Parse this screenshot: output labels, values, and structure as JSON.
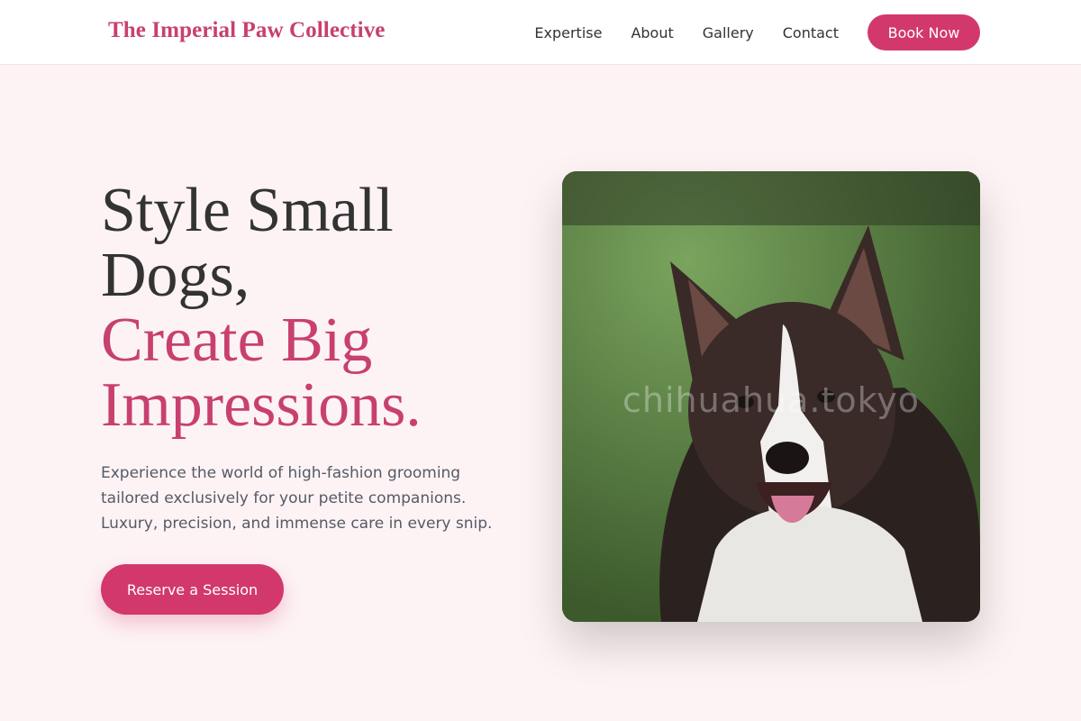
{
  "header": {
    "brand": "The Imperial Paw Collective",
    "nav": [
      "Expertise",
      "About",
      "Gallery",
      "Contact"
    ],
    "cta": "Book Now"
  },
  "hero": {
    "title_line1": "Style Small",
    "title_line2": "Dogs,",
    "title_accent1": "Create Big",
    "title_accent2": "Impressions.",
    "description": "Experience the world of high-fashion grooming tailored exclusively for your petite companions. Luxury, precision, and immense care in every snip.",
    "cta": "Reserve a Session",
    "image_watermark": "chihuahua.tokyo"
  },
  "colors": {
    "accent": "#d2386c",
    "brand": "#c8406f",
    "page_background": "#fdf3f4"
  }
}
